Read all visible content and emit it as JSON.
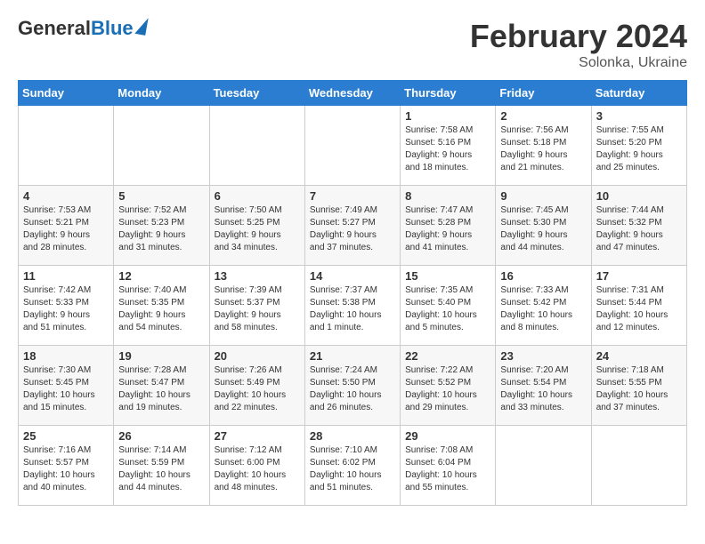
{
  "logo": {
    "general": "General",
    "blue": "Blue"
  },
  "header": {
    "title": "February 2024",
    "subtitle": "Solonka, Ukraine"
  },
  "days_of_week": [
    "Sunday",
    "Monday",
    "Tuesday",
    "Wednesday",
    "Thursday",
    "Friday",
    "Saturday"
  ],
  "weeks": [
    [
      {
        "day": "",
        "info": ""
      },
      {
        "day": "",
        "info": ""
      },
      {
        "day": "",
        "info": ""
      },
      {
        "day": "",
        "info": ""
      },
      {
        "day": "1",
        "info": "Sunrise: 7:58 AM\nSunset: 5:16 PM\nDaylight: 9 hours\nand 18 minutes."
      },
      {
        "day": "2",
        "info": "Sunrise: 7:56 AM\nSunset: 5:18 PM\nDaylight: 9 hours\nand 21 minutes."
      },
      {
        "day": "3",
        "info": "Sunrise: 7:55 AM\nSunset: 5:20 PM\nDaylight: 9 hours\nand 25 minutes."
      }
    ],
    [
      {
        "day": "4",
        "info": "Sunrise: 7:53 AM\nSunset: 5:21 PM\nDaylight: 9 hours\nand 28 minutes."
      },
      {
        "day": "5",
        "info": "Sunrise: 7:52 AM\nSunset: 5:23 PM\nDaylight: 9 hours\nand 31 minutes."
      },
      {
        "day": "6",
        "info": "Sunrise: 7:50 AM\nSunset: 5:25 PM\nDaylight: 9 hours\nand 34 minutes."
      },
      {
        "day": "7",
        "info": "Sunrise: 7:49 AM\nSunset: 5:27 PM\nDaylight: 9 hours\nand 37 minutes."
      },
      {
        "day": "8",
        "info": "Sunrise: 7:47 AM\nSunset: 5:28 PM\nDaylight: 9 hours\nand 41 minutes."
      },
      {
        "day": "9",
        "info": "Sunrise: 7:45 AM\nSunset: 5:30 PM\nDaylight: 9 hours\nand 44 minutes."
      },
      {
        "day": "10",
        "info": "Sunrise: 7:44 AM\nSunset: 5:32 PM\nDaylight: 9 hours\nand 47 minutes."
      }
    ],
    [
      {
        "day": "11",
        "info": "Sunrise: 7:42 AM\nSunset: 5:33 PM\nDaylight: 9 hours\nand 51 minutes."
      },
      {
        "day": "12",
        "info": "Sunrise: 7:40 AM\nSunset: 5:35 PM\nDaylight: 9 hours\nand 54 minutes."
      },
      {
        "day": "13",
        "info": "Sunrise: 7:39 AM\nSunset: 5:37 PM\nDaylight: 9 hours\nand 58 minutes."
      },
      {
        "day": "14",
        "info": "Sunrise: 7:37 AM\nSunset: 5:38 PM\nDaylight: 10 hours\nand 1 minute."
      },
      {
        "day": "15",
        "info": "Sunrise: 7:35 AM\nSunset: 5:40 PM\nDaylight: 10 hours\nand 5 minutes."
      },
      {
        "day": "16",
        "info": "Sunrise: 7:33 AM\nSunset: 5:42 PM\nDaylight: 10 hours\nand 8 minutes."
      },
      {
        "day": "17",
        "info": "Sunrise: 7:31 AM\nSunset: 5:44 PM\nDaylight: 10 hours\nand 12 minutes."
      }
    ],
    [
      {
        "day": "18",
        "info": "Sunrise: 7:30 AM\nSunset: 5:45 PM\nDaylight: 10 hours\nand 15 minutes."
      },
      {
        "day": "19",
        "info": "Sunrise: 7:28 AM\nSunset: 5:47 PM\nDaylight: 10 hours\nand 19 minutes."
      },
      {
        "day": "20",
        "info": "Sunrise: 7:26 AM\nSunset: 5:49 PM\nDaylight: 10 hours\nand 22 minutes."
      },
      {
        "day": "21",
        "info": "Sunrise: 7:24 AM\nSunset: 5:50 PM\nDaylight: 10 hours\nand 26 minutes."
      },
      {
        "day": "22",
        "info": "Sunrise: 7:22 AM\nSunset: 5:52 PM\nDaylight: 10 hours\nand 29 minutes."
      },
      {
        "day": "23",
        "info": "Sunrise: 7:20 AM\nSunset: 5:54 PM\nDaylight: 10 hours\nand 33 minutes."
      },
      {
        "day": "24",
        "info": "Sunrise: 7:18 AM\nSunset: 5:55 PM\nDaylight: 10 hours\nand 37 minutes."
      }
    ],
    [
      {
        "day": "25",
        "info": "Sunrise: 7:16 AM\nSunset: 5:57 PM\nDaylight: 10 hours\nand 40 minutes."
      },
      {
        "day": "26",
        "info": "Sunrise: 7:14 AM\nSunset: 5:59 PM\nDaylight: 10 hours\nand 44 minutes."
      },
      {
        "day": "27",
        "info": "Sunrise: 7:12 AM\nSunset: 6:00 PM\nDaylight: 10 hours\nand 48 minutes."
      },
      {
        "day": "28",
        "info": "Sunrise: 7:10 AM\nSunset: 6:02 PM\nDaylight: 10 hours\nand 51 minutes."
      },
      {
        "day": "29",
        "info": "Sunrise: 7:08 AM\nSunset: 6:04 PM\nDaylight: 10 hours\nand 55 minutes."
      },
      {
        "day": "",
        "info": ""
      },
      {
        "day": "",
        "info": ""
      }
    ]
  ]
}
